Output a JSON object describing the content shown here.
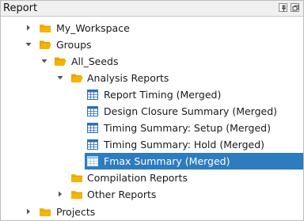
{
  "panel": {
    "title": "Report",
    "pin_icon": "pin-icon",
    "restore_icon": "restore-window-icon"
  },
  "colors": {
    "folder": "#f4b400",
    "selection": "#2d7cc0",
    "report_icon": "#2f6fb5"
  },
  "tree": {
    "items": [
      {
        "label": "My_Workspace",
        "icon": "folder-icon",
        "expanded": false
      },
      {
        "label": "Groups",
        "icon": "folder-open-icon",
        "expanded": true
      },
      {
        "label": "All_Seeds",
        "icon": "folder-open-icon",
        "expanded": true
      },
      {
        "label": "Analysis Reports",
        "icon": "folder-open-icon",
        "expanded": true
      },
      {
        "label": "Report Timing (Merged)",
        "icon": "report-table-icon"
      },
      {
        "label": "Design Closure Summary (Merged)",
        "icon": "report-table-icon"
      },
      {
        "label": "Timing Summary: Setup (Merged)",
        "icon": "report-table-icon"
      },
      {
        "label": "Timing Summary: Hold (Merged)",
        "icon": "report-table-icon"
      },
      {
        "label": "Fmax Summary (Merged)",
        "icon": "report-table-icon",
        "selected": true
      },
      {
        "label": "Compilation Reports",
        "icon": "folder-icon"
      },
      {
        "label": "Other Reports",
        "icon": "folder-icon",
        "expanded": false
      },
      {
        "label": "Projects",
        "icon": "folder-icon",
        "expanded": false
      }
    ]
  }
}
